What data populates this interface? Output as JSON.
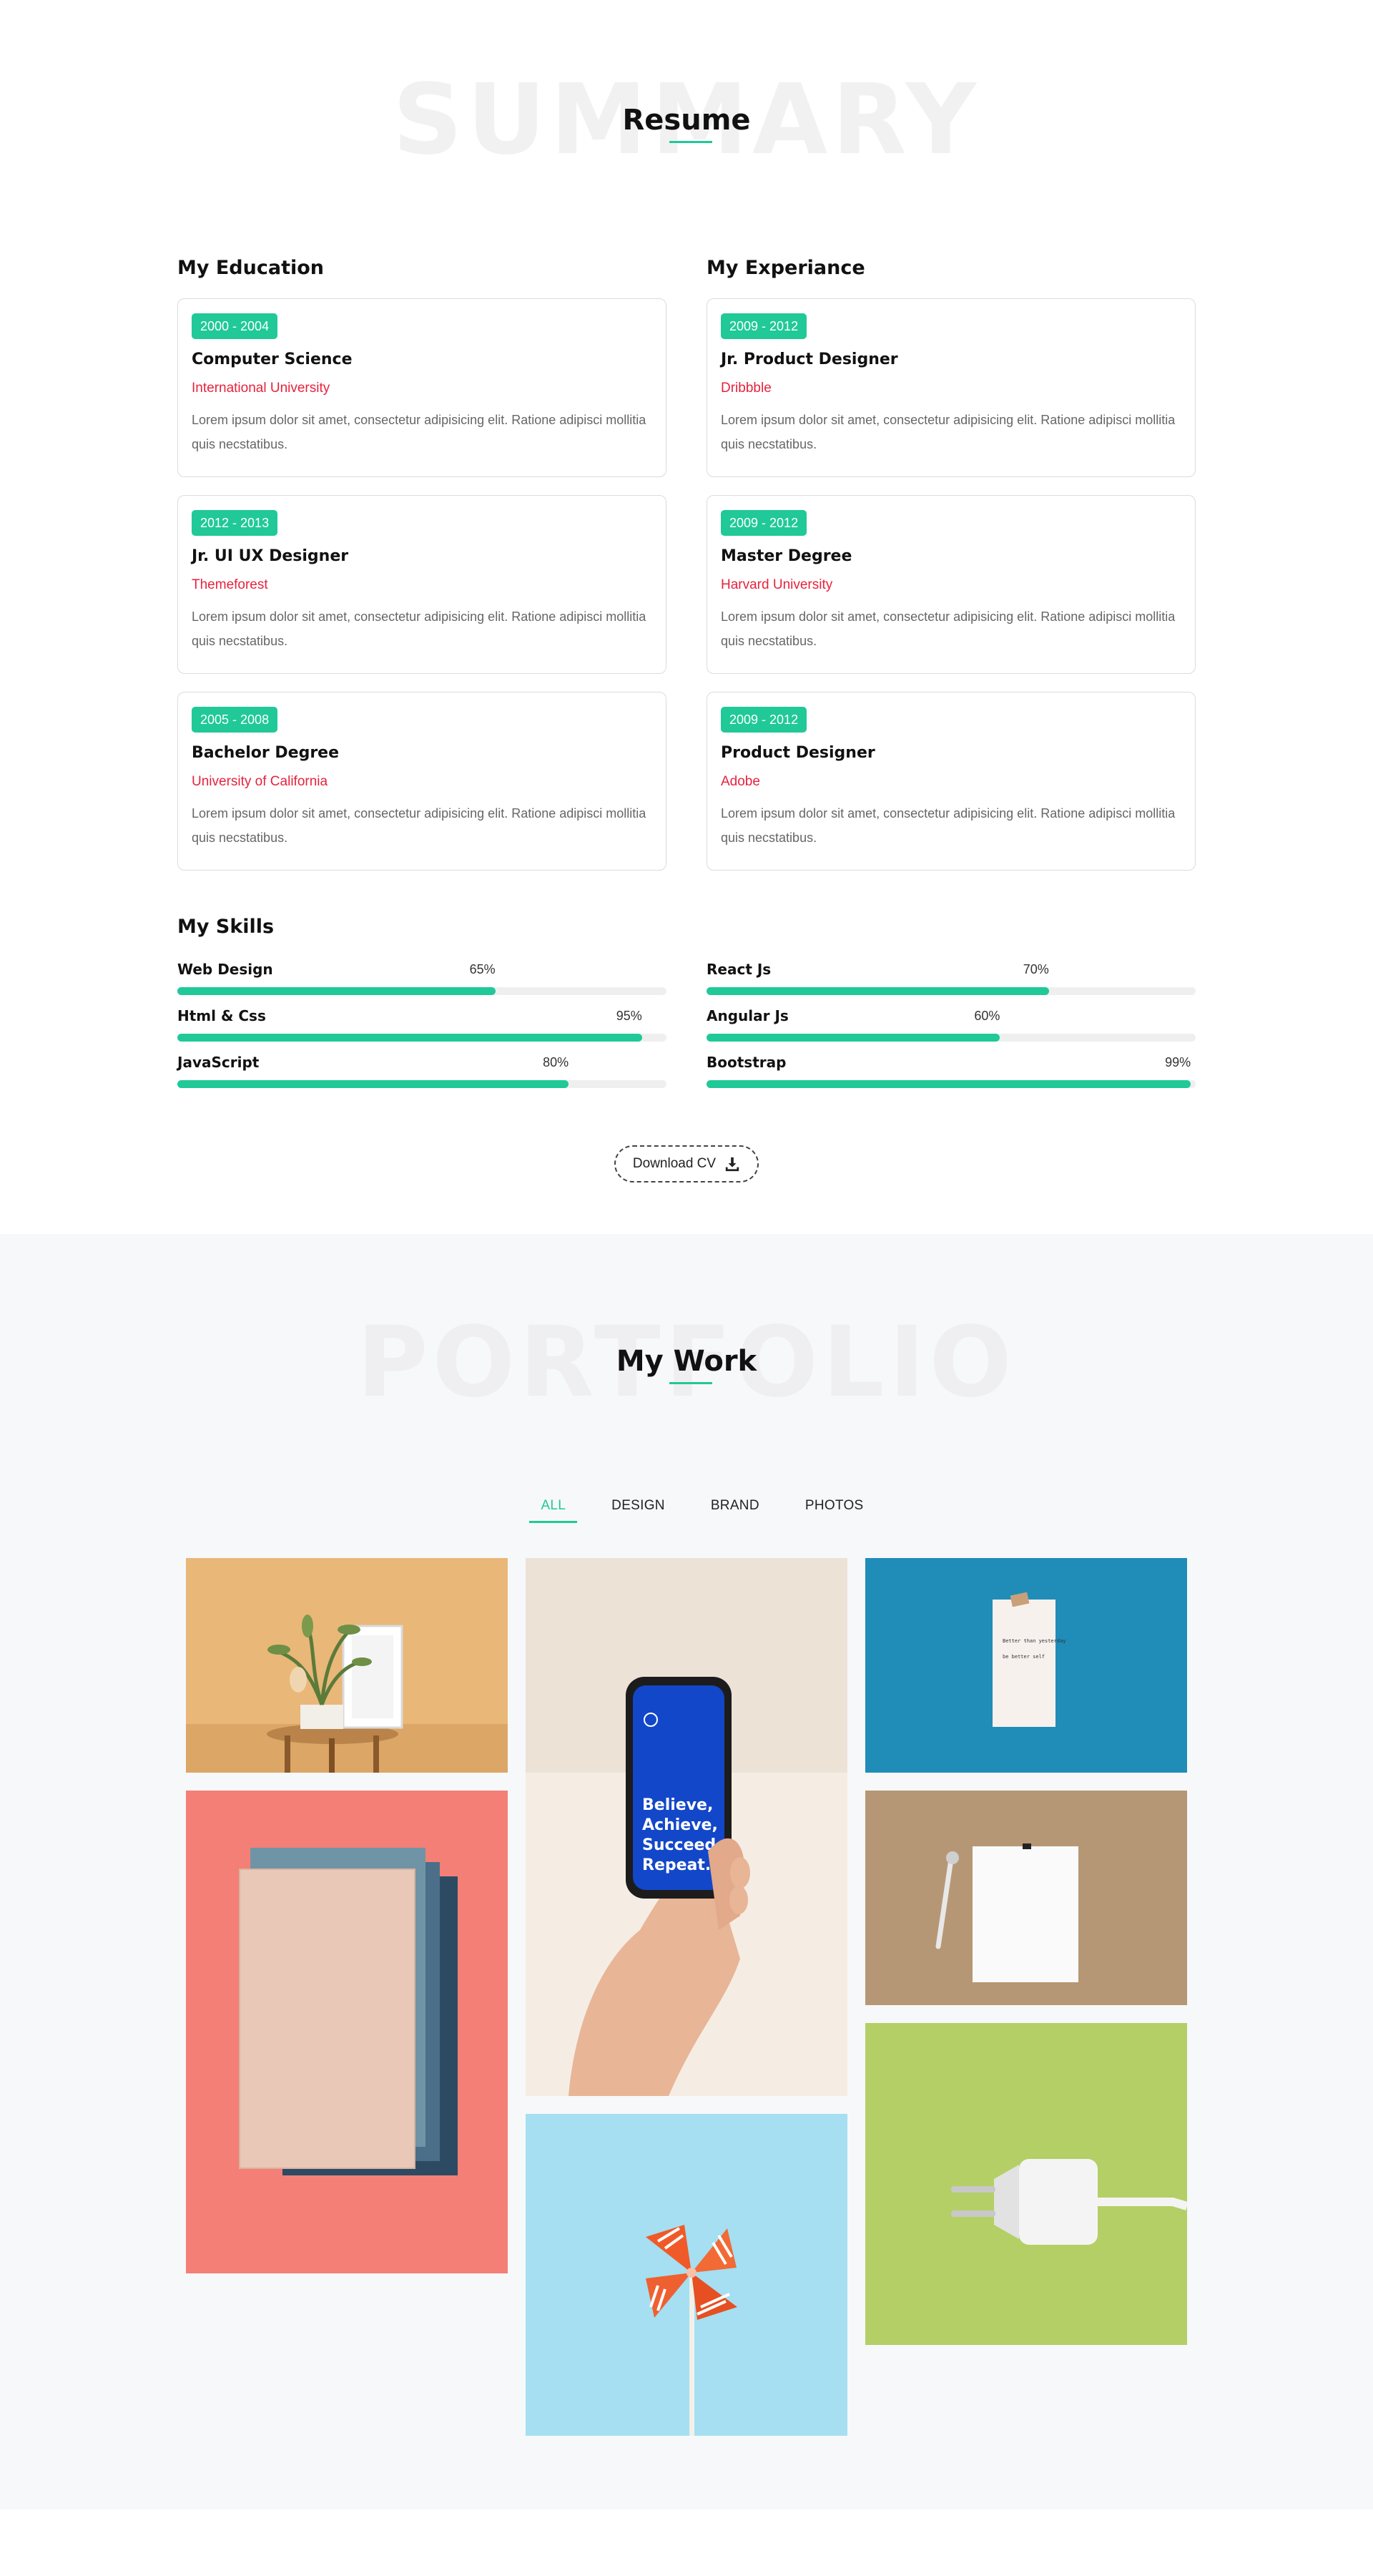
{
  "resume": {
    "bg_word": "SUMMARY",
    "title": "Resume",
    "education": {
      "title": "My Education",
      "items": [
        {
          "years": "2000 - 2004",
          "title": "Computer Science",
          "place": "International University",
          "desc": "Lorem ipsum dolor sit amet, consectetur adipisicing elit. Ratione adipisci mollitia quis necstatibus."
        },
        {
          "years": "2012 - 2013",
          "title": "Jr. UI UX Designer",
          "place": "Themeforest",
          "desc": "Lorem ipsum dolor sit amet, consectetur adipisicing elit. Ratione adipisci mollitia quis necstatibus."
        },
        {
          "years": "2005 - 2008",
          "title": "Bachelor Degree",
          "place": "University of California",
          "desc": "Lorem ipsum dolor sit amet, consectetur adipisicing elit. Ratione adipisci mollitia quis necstatibus."
        }
      ]
    },
    "experience": {
      "title": "My Experiance",
      "items": [
        {
          "years": "2009 - 2012",
          "title": "Jr. Product Designer",
          "place": "Dribbble",
          "desc": "Lorem ipsum dolor sit amet, consectetur adipisicing elit. Ratione adipisci mollitia quis necstatibus."
        },
        {
          "years": "2009 - 2012",
          "title": "Master Degree",
          "place": "Harvard University",
          "desc": "Lorem ipsum dolor sit amet, consectetur adipisicing elit. Ratione adipisci mollitia quis necstatibus."
        },
        {
          "years": "2009 - 2012",
          "title": "Product Designer",
          "place": "Adobe",
          "desc": "Lorem ipsum dolor sit amet, consectetur adipisicing elit. Ratione adipisci mollitia quis necstatibus."
        }
      ]
    },
    "skills": {
      "title": "My Skills",
      "left": [
        {
          "name": "Web Design",
          "percent_label": "65%",
          "value": 65
        },
        {
          "name": "Html & Css",
          "percent_label": "95%",
          "value": 95
        },
        {
          "name": "JavaScript",
          "percent_label": "80%",
          "value": 80
        }
      ],
      "right": [
        {
          "name": "React Js",
          "percent_label": "70%",
          "value": 70
        },
        {
          "name": "Angular Js",
          "percent_label": "60%",
          "value": 60
        },
        {
          "name": "Bootstrap",
          "percent_label": "99%",
          "value": 99
        }
      ]
    },
    "download_label": "Download CV",
    "download_icon": "download-icon"
  },
  "portfolio": {
    "bg_word": "PORTFOLIO",
    "title": "My Work",
    "filters": [
      "ALL",
      "DESIGN",
      "BRAND",
      "PHOTOS"
    ],
    "active_filter": "ALL",
    "phone_text": [
      "Believe,",
      "Achieve,",
      "Succeed,",
      "Repeat."
    ],
    "note_text": [
      "Better than yesterday",
      "be better self"
    ]
  },
  "colors": {
    "accent": "#20c997",
    "subtitle_red": "#e6223c",
    "portfolio_bg": "#f7f8fa"
  }
}
